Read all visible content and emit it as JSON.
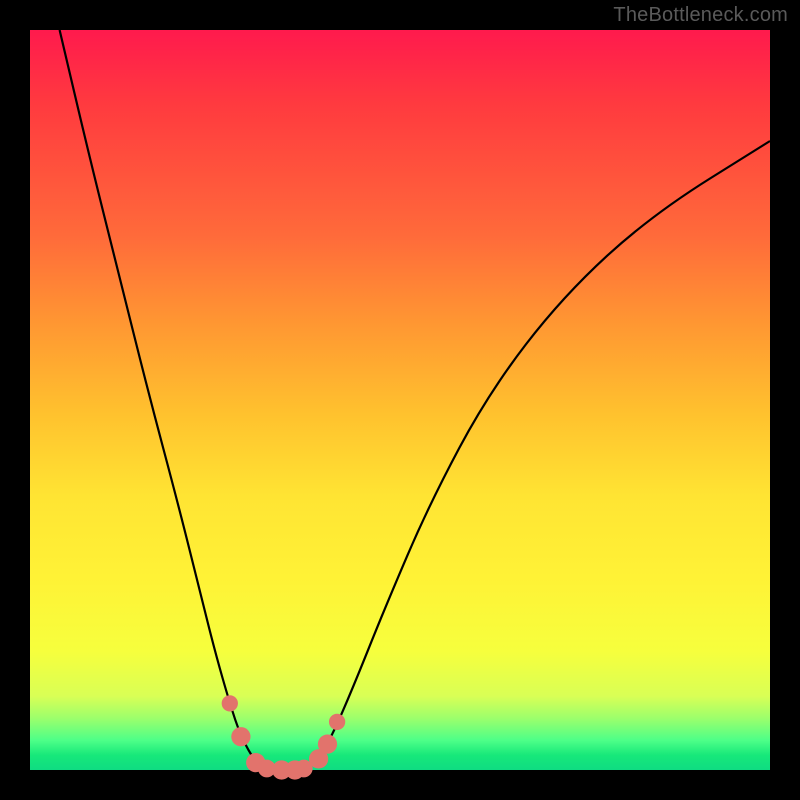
{
  "watermark": "TheBottleneck.com",
  "colors": {
    "frame": "#000000",
    "curve": "#000000",
    "marker_fill": "#e2736c",
    "marker_stroke": "#b85a54",
    "gradient_top": "#ff1a4d",
    "gradient_bottom": "#0fdc82"
  },
  "chart_data": {
    "type": "line",
    "title": "",
    "xlabel": "",
    "ylabel": "",
    "xlim": [
      0,
      100
    ],
    "ylim": [
      0,
      100
    ],
    "grid": false,
    "legend": false,
    "series": [
      {
        "name": "left-branch",
        "x": [
          4,
          8,
          12,
          16,
          20,
          23,
          25,
          27,
          28.5,
          30.5,
          32
        ],
        "y": [
          100,
          83,
          67,
          51,
          36,
          24,
          16,
          9,
          4.5,
          1,
          0
        ]
      },
      {
        "name": "right-branch",
        "x": [
          37,
          39,
          41,
          44,
          48,
          54,
          62,
          72,
          84,
          100
        ],
        "y": [
          0,
          1.5,
          5,
          12,
          22,
          36,
          51,
          64,
          75,
          85
        ]
      }
    ],
    "flat_bottom": {
      "x": [
        32,
        37
      ],
      "y": [
        0,
        0
      ]
    },
    "markers": [
      {
        "x": 27.0,
        "y": 9.0,
        "r": 1.1
      },
      {
        "x": 28.5,
        "y": 4.5,
        "r": 1.3
      },
      {
        "x": 30.5,
        "y": 1.0,
        "r": 1.3
      },
      {
        "x": 32.0,
        "y": 0.2,
        "r": 1.2
      },
      {
        "x": 34.0,
        "y": 0.0,
        "r": 1.3
      },
      {
        "x": 35.8,
        "y": 0.0,
        "r": 1.3
      },
      {
        "x": 37.0,
        "y": 0.2,
        "r": 1.2
      },
      {
        "x": 39.0,
        "y": 1.5,
        "r": 1.3
      },
      {
        "x": 40.2,
        "y": 3.5,
        "r": 1.3
      },
      {
        "x": 41.5,
        "y": 6.5,
        "r": 1.1
      }
    ]
  }
}
